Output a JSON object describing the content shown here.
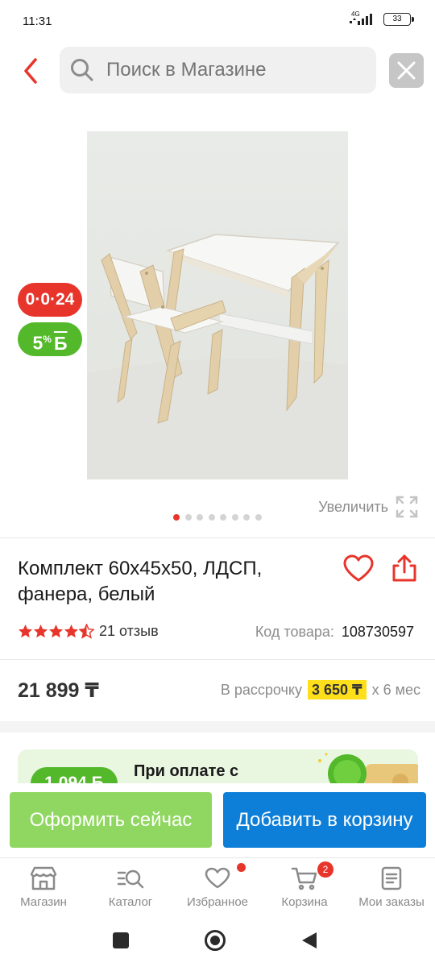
{
  "status": {
    "time": "11:31",
    "network": "4G",
    "battery": "33"
  },
  "header": {
    "search_placeholder": "Поиск в Магазине"
  },
  "gallery": {
    "badge_installment": "0·0·24",
    "badge_bonus_value": "5",
    "badge_bonus_percent": "%",
    "badge_bonus_currency": "Б",
    "zoom_label": "Увеличить",
    "dot_count": 8,
    "active_dot": 0
  },
  "product": {
    "title": "Комплект 60х45х50, ЛДСП, фанера, белый",
    "rating": 4.5,
    "reviews": "21 отзыв",
    "sku_label": "Код товара:",
    "sku_value": "108730597",
    "price": "21 899 ₸",
    "installment_prefix": "В рассрочку",
    "installment_amount": "3 650 ₸",
    "installment_suffix": "х 6 мес"
  },
  "promo": {
    "bonus_amount": "1 094 Б",
    "text": "При оплате с"
  },
  "actions": {
    "buy_now": "Оформить сейчас",
    "add_to_cart": "Добавить в корзину"
  },
  "tabbar": {
    "items": [
      {
        "label": "Магазин",
        "icon": "store-icon"
      },
      {
        "label": "Каталог",
        "icon": "catalog-icon"
      },
      {
        "label": "Избранное",
        "icon": "heart-icon"
      },
      {
        "label": "Корзина",
        "icon": "cart-icon"
      },
      {
        "label": "Мои заказы",
        "icon": "orders-icon"
      }
    ],
    "cart_count": "2"
  },
  "colors": {
    "accent_red": "#e8352b",
    "bonus_green": "#54b82b",
    "buy_now_green": "#8fd760",
    "cart_blue": "#0e7fd8",
    "installment_yellow": "#ffdf1a"
  }
}
